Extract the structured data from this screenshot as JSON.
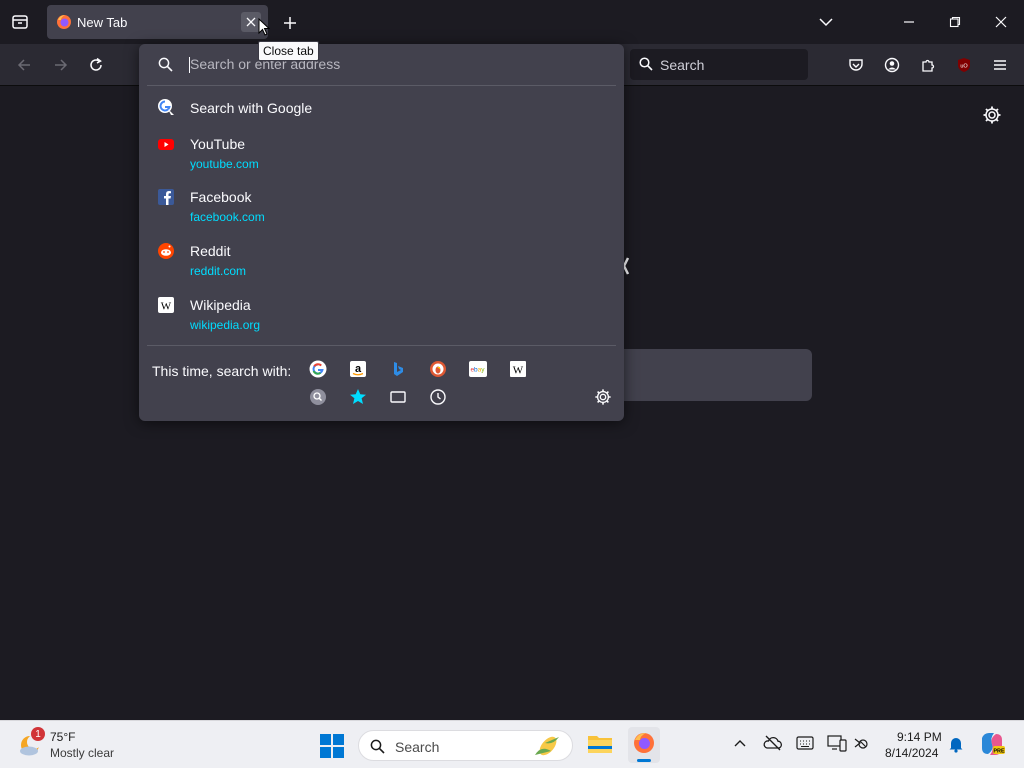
{
  "browser": {
    "tab": {
      "title": "New Tab"
    },
    "tooltip": "Close tab",
    "search_placeholder": "Search",
    "urlbar": {
      "placeholder": "Search or enter address",
      "results": [
        {
          "title": "Search with Google",
          "url": "",
          "icon": "google-search-icon"
        },
        {
          "title": "YouTube",
          "url": "youtube.com",
          "icon": "youtube-icon"
        },
        {
          "title": "Facebook",
          "url": "facebook.com",
          "icon": "facebook-icon"
        },
        {
          "title": "Reddit",
          "url": "reddit.com",
          "icon": "reddit-icon"
        },
        {
          "title": "Wikipedia",
          "url": "wikipedia.org",
          "icon": "wikipedia-icon"
        }
      ],
      "search_with_label": "This time, search with:",
      "engines": [
        "google-icon",
        "amazon-icon",
        "bing-icon",
        "duckduckgo-icon",
        "ebay-icon",
        "wikipedia-icon"
      ],
      "modes": [
        "history-search-icon",
        "bookmarks-icon",
        "tabs-icon",
        "history-icon"
      ]
    }
  },
  "taskbar": {
    "weather": {
      "temp": "75°F",
      "desc": "Mostly clear",
      "badge": "1"
    },
    "search_label": "Search",
    "clock": {
      "time": "9:14 PM",
      "date": "8/14/2024"
    }
  },
  "colors": {
    "accent_cyan": "#00ddff",
    "popup_bg": "#42414d",
    "toolbar_bg": "#2b2a33",
    "page_bg": "#1c1b22"
  }
}
